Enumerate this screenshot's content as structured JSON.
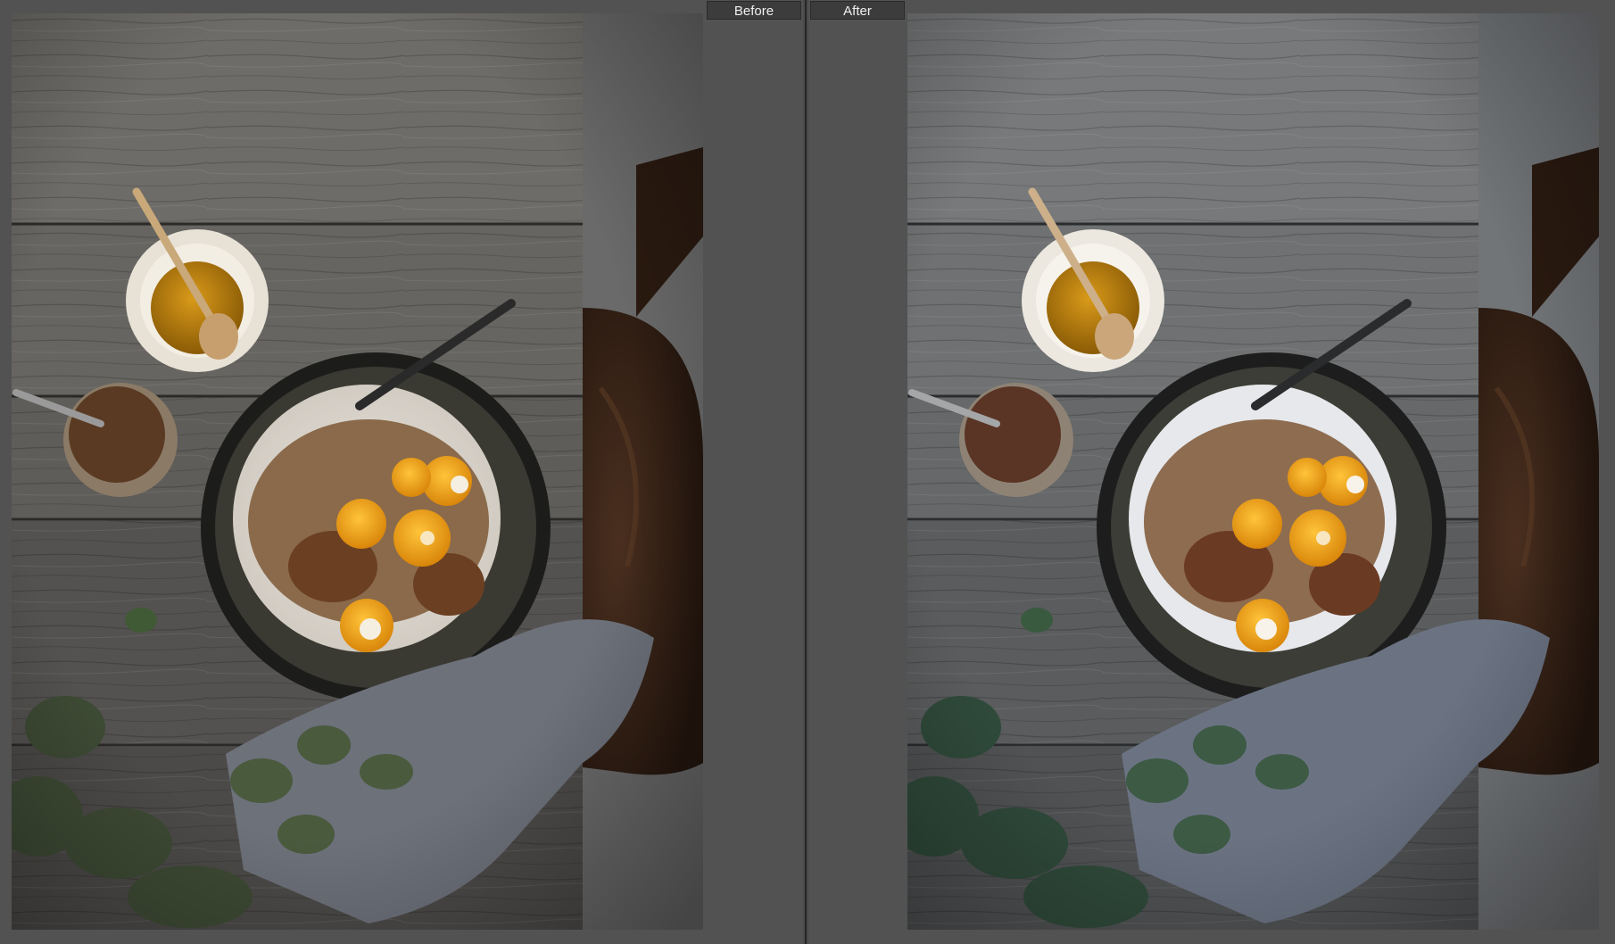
{
  "compare_view": {
    "before_label": "Before",
    "after_label": "After"
  },
  "colors": {
    "ui_background": "#525252",
    "label_background": "#3c3c3c",
    "label_text": "#f0f0f0",
    "divider": "#262626"
  }
}
